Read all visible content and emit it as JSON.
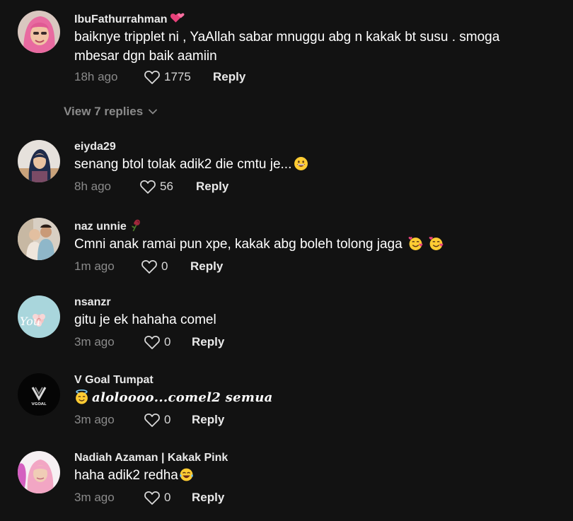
{
  "comments": [
    {
      "username": "IbuFathurrahman",
      "text": "baiknye tripplet ni , YaAllah sabar mnuggu abg n kakak bt susu . smoga mbesar dgn baik aamiin",
      "time": "18h ago",
      "likes": "1775",
      "reply_label": "Reply",
      "username_emoji": "two-hearts-emoji"
    },
    {
      "username": "eiyda29",
      "text": "senang btol tolak adik2 die cmtu je...",
      "time": "8h ago",
      "likes": "56",
      "reply_label": "Reply",
      "text_emoji": "grinning-face-emoji"
    },
    {
      "username": "naz unnie",
      "text": "Cmni anak ramai pun xpe, kakak abg boleh tolong jaga",
      "time": "1m ago",
      "likes": "0",
      "reply_label": "Reply",
      "username_emoji": "wilted-rose-emoji",
      "text_emoji": "smiling-face-with-hearts-emoji"
    },
    {
      "username": "nsanzr",
      "text": "gitu je ek hahaha comel",
      "time": "3m ago",
      "likes": "0",
      "reply_label": "Reply",
      "avatar_text": "You"
    },
    {
      "username": "V Goal Tumpat",
      "text": "𝒂𝒍𝒐𝒍𝒐𝒐𝒐𝒐...𝒄𝒐𝒎𝒆𝒍2 𝒔𝒆𝒎𝒖𝒂",
      "time": "3m ago",
      "likes": "0",
      "reply_label": "Reply",
      "avatar_text": "VGOAL",
      "text_emoji": "smiling-face-with-halo-emoji"
    },
    {
      "username": "Nadiah Azaman | Kakak Pink",
      "text": "haha adik2 redha",
      "time": "3m ago",
      "likes": "0",
      "reply_label": "Reply",
      "text_emoji": "face-with-tears-of-joy-emoji"
    }
  ],
  "view_replies": {
    "label": "View 7 replies"
  },
  "colors": {
    "background": "#121212",
    "muted": "#8a8a8a",
    "text": "#ffffff"
  }
}
